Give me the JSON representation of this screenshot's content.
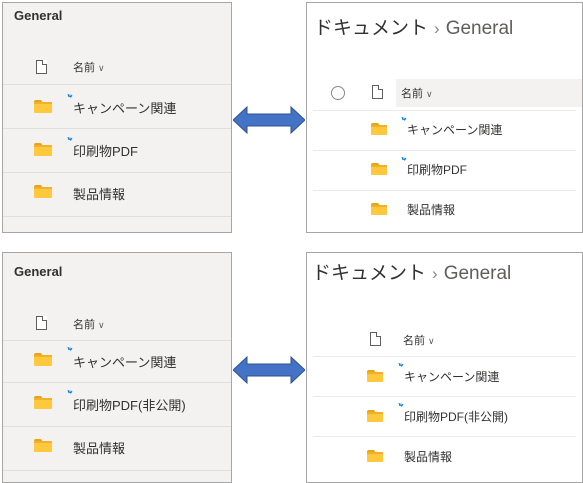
{
  "column_header": "名前",
  "folders": [
    "キャンペーン関連",
    "印刷物PDF",
    "製品情報"
  ],
  "folders_after": [
    "キャンペーン関連",
    "印刷物PDF(非公開)",
    "製品情報"
  ],
  "top_left": {
    "title": "General"
  },
  "top_right": {
    "breadcrumb_root": "ドキュメント",
    "breadcrumb_current": "General"
  },
  "bottom_left": {
    "title": "General"
  },
  "bottom_right": {
    "breadcrumb_root": "ドキュメント",
    "breadcrumb_current": "General"
  },
  "icons": {
    "file": "file-icon",
    "folder": "folder-icon",
    "new": "new-item-icon",
    "chevron": "chevron-down-icon",
    "arrow": "double-arrow-icon"
  },
  "colors": {
    "folder": "#ffc83d",
    "arrow": "#4472c4",
    "new_marker": "#0078d4"
  }
}
